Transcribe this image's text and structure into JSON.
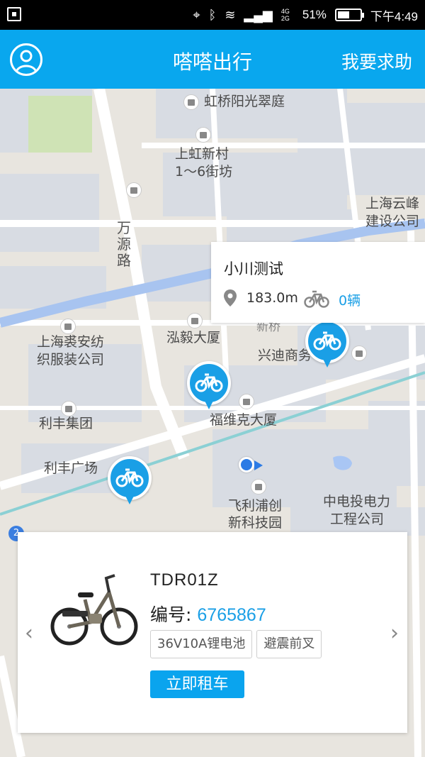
{
  "status_bar": {
    "signal_labels": "4G 2G",
    "battery_percent": "51%",
    "time": "下午4:49"
  },
  "header": {
    "title": "嗒嗒出行",
    "help_label": "我要求助"
  },
  "map": {
    "pois": [
      {
        "id": "hongqiao",
        "text": "虹桥阳光翠庭"
      },
      {
        "id": "shanghong",
        "text": "上虹新村"
      },
      {
        "id": "shanghong2",
        "text": "1～6街坊"
      },
      {
        "id": "yunfeng1",
        "text": "上海云峰"
      },
      {
        "id": "yunfeng2",
        "text": "建设公司"
      },
      {
        "id": "hongyi",
        "text": "泓毅大厦"
      },
      {
        "id": "qiuan1",
        "text": "上海裘安纺"
      },
      {
        "id": "qiuan2",
        "text": "织服装公司"
      },
      {
        "id": "xingdi",
        "text": "兴迪商务"
      },
      {
        "id": "fuweike",
        "text": "福维克大厦"
      },
      {
        "id": "lifeng",
        "text": "利丰集团"
      },
      {
        "id": "lifengsq",
        "text": "利丰广场"
      },
      {
        "id": "philips1",
        "text": "飞利浦创"
      },
      {
        "id": "philips2",
        "text": "新科技园"
      },
      {
        "id": "cpi1",
        "text": "中电投电力"
      },
      {
        "id": "cpi2",
        "text": "工程公司"
      },
      {
        "id": "xinqiao",
        "text": "新桥"
      }
    ],
    "road_label": "万源路",
    "marker_badge": "2"
  },
  "popup": {
    "name": "小川测试",
    "distance": "183.0m",
    "bike_count": "0辆"
  },
  "bike_card": {
    "model": "TDR01Z",
    "code_label": "编号:",
    "code": "6765867",
    "tags": [
      "36V10A锂电池",
      "避震前叉"
    ],
    "rent_label": "立即租车"
  },
  "colors": {
    "primary": "#09a7ee",
    "accent_blue": "#1a9fe6"
  }
}
